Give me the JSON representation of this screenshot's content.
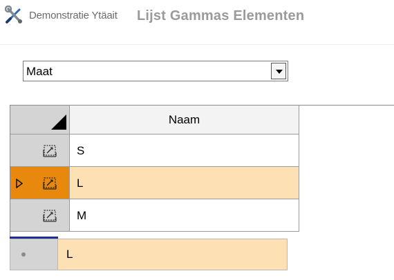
{
  "window": {
    "caption_sub": "Demonstratie Ytäait",
    "caption_main": "Lijst Gammas Elementen",
    "app_icon": "tools-icon"
  },
  "filter": {
    "selected": "Maat",
    "arrow_icon": "chevron-down-icon"
  },
  "grid": {
    "column_header": "Naam",
    "rows": [
      {
        "name": "S",
        "selected": false
      },
      {
        "name": "L",
        "selected": true
      },
      {
        "name": "M",
        "selected": false
      }
    ],
    "row_icon": "edit-record-icon",
    "pointer_icon": "current-row-pointer-icon"
  },
  "detail": {
    "value": "L"
  },
  "colors": {
    "selected_row_header": "#e8890e",
    "selected_row": "#fde0b4",
    "header_gray": "#d4d4d4",
    "detail_marker": "#1f2d9a"
  }
}
